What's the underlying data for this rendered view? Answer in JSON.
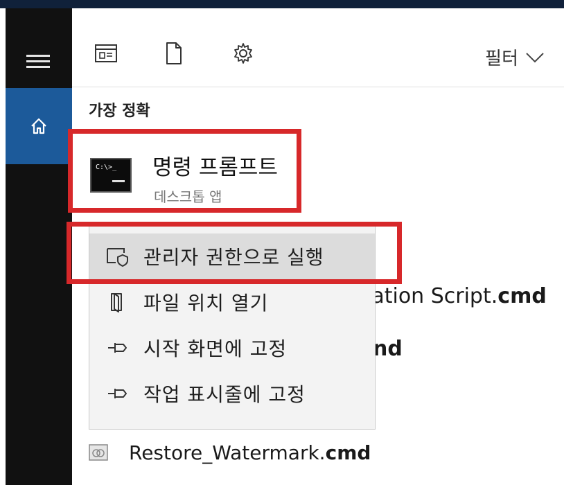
{
  "toolbar": {
    "icons": [
      "apps-icon",
      "document-icon",
      "settings-gear-icon"
    ],
    "filter_label": "필터"
  },
  "section": {
    "label": "가장 정확"
  },
  "best_match": {
    "title": "명령 프롬프트",
    "subtitle": "데스크톱 앱",
    "icon": "command-prompt-icon",
    "icon_text": "C:\\>_"
  },
  "context_menu": {
    "items": [
      {
        "label": "관리자 권한으로 실행",
        "icon": "run-as-admin-icon",
        "selected": true
      },
      {
        "label": "파일 위치 열기",
        "icon": "open-folder-icon"
      },
      {
        "label": "시작 화면에 고정",
        "icon": "pin-icon"
      },
      {
        "label": "작업 표시줄에 고정",
        "icon": "pin-icon"
      }
    ]
  },
  "results": {
    "partial_1_regular": "ration Script.",
    "partial_1_bold": "cmd",
    "partial_2_bold": "nd",
    "restore_name": "Restore_Watermark.",
    "restore_ext": "cmd"
  },
  "colors": {
    "highlight_border": "#d7282a",
    "rail_background": "#111111",
    "rail_selected": "#1c5a9a",
    "menu_background": "#f3f3f3"
  }
}
